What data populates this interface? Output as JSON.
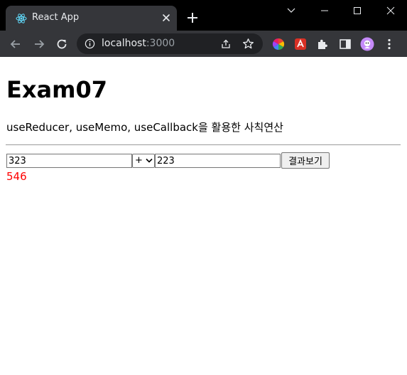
{
  "browser": {
    "tab_title": "React App",
    "url_host": "localhost",
    "url_port": ":3000"
  },
  "page": {
    "heading": "Exam07",
    "description": "useReducer, useMemo, useCallback을 활용한 사칙연산",
    "num1": "323",
    "operator": "+",
    "num2": "223",
    "submit_label": "결과보기",
    "result": "546"
  },
  "colors": {
    "result_color": "#ff0000"
  }
}
